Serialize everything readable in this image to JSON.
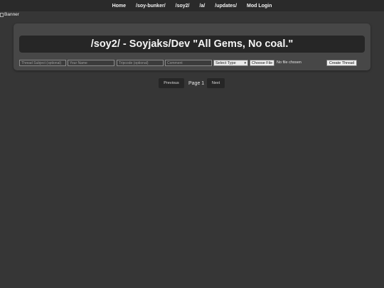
{
  "nav": {
    "items": [
      {
        "label": "Home"
      },
      {
        "label": "/soy-bunker/"
      },
      {
        "label": "/soy2/"
      },
      {
        "label": "/a/"
      },
      {
        "label": "/updates/"
      },
      {
        "label": "Mod Login"
      }
    ]
  },
  "banner": {
    "alt": "Banner"
  },
  "board": {
    "title": "/soy2/ - Soyjaks/Dev \"All Gems, No coal.\""
  },
  "form": {
    "subject_placeholder": "Thread Subject (optional)",
    "name_placeholder": "Your Name",
    "tripcode_placeholder": "Tripcode (optional)",
    "comment_placeholder": "Comment",
    "type_select": "Select Type",
    "choose_file": "Choose File",
    "no_file": "No file chosen",
    "submit": "Create Thread"
  },
  "pagination": {
    "previous": "Previous",
    "page": "Page 1",
    "next": "Next"
  }
}
